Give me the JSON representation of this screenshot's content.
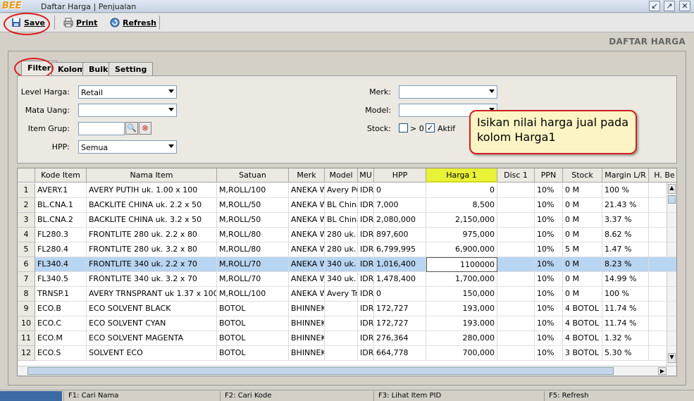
{
  "window": {
    "logo": "BEE",
    "title": "Daftar Harga | Penjualan"
  },
  "toolbar": {
    "save": "Save",
    "print": "Print",
    "refresh": "Refresh"
  },
  "page_title": "DAFTAR HARGA",
  "tabs": [
    "Filter",
    "Kolom",
    "Bulk",
    "Setting"
  ],
  "filter": {
    "level_harga_label": "Level Harga:",
    "level_harga_value": "Retail",
    "mata_uang_label": "Mata Uang:",
    "mata_uang_value": "",
    "item_grup_label": "Item Grup:",
    "hpp_label": "HPP:",
    "hpp_value": "Semua",
    "merk_label": "Merk:",
    "model_label": "Model:",
    "stock_label": "Stock:",
    "stock_gt0": "> 0",
    "aktif": "Aktif"
  },
  "callout": "Isikan nilai harga jual pada kolom Harga1",
  "columns": [
    "Kode Item",
    "Nama Item",
    "Satuan",
    "Merk",
    "Model",
    "MU",
    "HPP",
    "Harga 1",
    "Disc 1",
    "PPN",
    "Stock",
    "Margin L/R",
    "H. Be"
  ],
  "rows": [
    [
      "1",
      "AVERY.1",
      "AVERY PUTIH uk. 1.00 x 100",
      "M,ROLL/100",
      "ANEKA W",
      "Avery Pu",
      "IDR",
      "0",
      "0",
      "",
      "10%",
      "0 M",
      "100 %"
    ],
    [
      "2",
      "BL.CNA.1",
      "BACKLITE CHINA uk. 2.2 x 50",
      "M,ROLL/50",
      "ANEKA W",
      "BL China",
      "IDR",
      "7,000",
      "8,500",
      "",
      "10%",
      "0 M",
      "21.43 %"
    ],
    [
      "3",
      "BL.CNA.2",
      "BACKLITE CHINA uk. 3.2 x 50",
      "M,ROLL/50",
      "ANEKA W",
      "BL China",
      "IDR",
      "2,080,000",
      "2,150,000",
      "",
      "10%",
      "0 M",
      "3.37 %"
    ],
    [
      "4",
      "FL280.3",
      "FRONTLITE 280 uk. 2.2 x 80",
      "M,ROLL/80",
      "ANEKA W",
      "280 uk. 2",
      "IDR",
      "897,600",
      "975,000",
      "",
      "10%",
      "0 M",
      "8.62 %"
    ],
    [
      "5",
      "FL280.4",
      "FRONTLITE 280 uk. 3.2 x 80",
      "M,ROLL/80",
      "ANEKA W",
      "280 uk. 3",
      "IDR",
      "6,799,995",
      "6,900,000",
      "",
      "10%",
      "5 M",
      "1.47 %"
    ],
    [
      "6",
      "FL340.4",
      "FRONTLITE 340 uk. 2.2 x 70",
      "M,ROLL/70",
      "ANEKA W",
      "340 uk. 2",
      "IDR",
      "1,016,400",
      "1100000",
      "",
      "10%",
      "0 M",
      "8.23 %"
    ],
    [
      "7",
      "FL340.5",
      "FRONTLITE 340 uk. 3.2 x 70",
      "M,ROLL/70",
      "ANEKA W",
      "340 uk. 3",
      "IDR",
      "1,478,400",
      "1,700,000",
      "",
      "10%",
      "0 M",
      "14.99 %"
    ],
    [
      "8",
      "TRNSP.1",
      "AVERY TRNSPRANT uk 1.37 x 100",
      "M,ROLL/100",
      "ANEKA W",
      "Avery Tr",
      "IDR",
      "0",
      "150,000",
      "",
      "10%",
      "0 M",
      "100 %"
    ],
    [
      "9",
      "ECO.B",
      "ECO SOLVENT BLACK",
      "BOTOL",
      "BHINNEKA",
      "",
      "IDR",
      "172,727",
      "193,000",
      "",
      "10%",
      "4 BOTOL",
      "11.74 %"
    ],
    [
      "10",
      "ECO.C",
      "ECO SOLVENT CYAN",
      "BOTOL",
      "BHINNEKA",
      "",
      "IDR",
      "172,727",
      "193,000",
      "",
      "10%",
      "4 BOTOL",
      "11.74 %"
    ],
    [
      "11",
      "ECO.M",
      "ECO SOLVENT MAGENTA",
      "BOTOL",
      "BHINNEKA",
      "",
      "IDR",
      "276,364",
      "280,000",
      "",
      "10%",
      "4 BOTOL",
      "1.32 %"
    ],
    [
      "12",
      "ECO.S",
      "SOLVENT ECO",
      "BOTOL",
      "BHINNEKA",
      "",
      "IDR",
      "664,778",
      "700,000",
      "",
      "10%",
      "3 BOTOL",
      "5.30 %"
    ]
  ],
  "statusbar": [
    "F1: Cari Nama",
    "F2: Cari Kode",
    "F3: Lihat Item PID",
    "F5: Refresh"
  ],
  "colors": {
    "highlight_col": "#e8f236",
    "selected_row": "#b8d5f2",
    "annotation": "#d02020",
    "callout_bg": "#fcf4c4"
  }
}
